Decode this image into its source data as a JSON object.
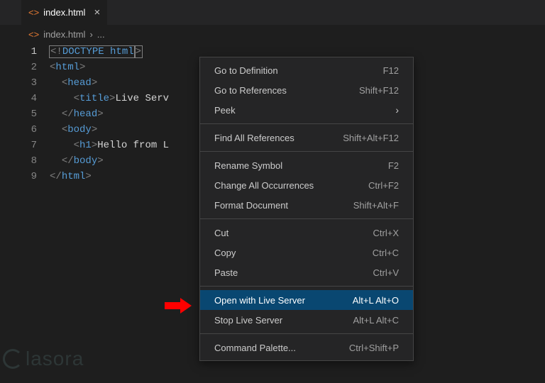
{
  "tab": {
    "filename": "index.html",
    "close_glyph": "×"
  },
  "breadcrumb": {
    "filename": "index.html",
    "sep": "›",
    "more": "..."
  },
  "gutter": {
    "l1": "1",
    "l2": "2",
    "l3": "3",
    "l4": "4",
    "l5": "5",
    "l6": "6",
    "l7": "7",
    "l8": "8",
    "l9": "9"
  },
  "code": {
    "doctype_open": "<!",
    "doctype_kw": "DOCTYPE ",
    "doctype_val": "html",
    "doctype_close": ">",
    "lt": "<",
    "gt": ">",
    "lts": "</",
    "html": "html",
    "head": "head",
    "title": "title",
    "body": "body",
    "h1": "h1",
    "title_text": "Live Serv",
    "h1_text": "Hello from L"
  },
  "menu": {
    "goto_def": {
      "label": "Go to Definition",
      "key": "F12"
    },
    "goto_ref": {
      "label": "Go to References",
      "key": "Shift+F12"
    },
    "peek": {
      "label": "Peek",
      "key": ""
    },
    "find_all": {
      "label": "Find All References",
      "key": "Shift+Alt+F12"
    },
    "rename": {
      "label": "Rename Symbol",
      "key": "F2"
    },
    "change_all": {
      "label": "Change All Occurrences",
      "key": "Ctrl+F2"
    },
    "format": {
      "label": "Format Document",
      "key": "Shift+Alt+F"
    },
    "cut": {
      "label": "Cut",
      "key": "Ctrl+X"
    },
    "copy": {
      "label": "Copy",
      "key": "Ctrl+C"
    },
    "paste": {
      "label": "Paste",
      "key": "Ctrl+V"
    },
    "open_live": {
      "label": "Open with Live Server",
      "key": "Alt+L Alt+O"
    },
    "stop_live": {
      "label": "Stop Live Server",
      "key": "Alt+L Alt+C"
    },
    "palette": {
      "label": "Command Palette...",
      "key": "Ctrl+Shift+P"
    }
  },
  "watermark": "lasora",
  "glyphs": {
    "chevron_right": "›"
  }
}
